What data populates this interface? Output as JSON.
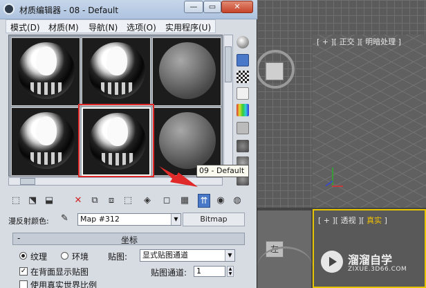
{
  "window": {
    "title": "材质编辑器 - 08 - Default",
    "minimize": "—",
    "restore": "▭",
    "close": "✕"
  },
  "menu": {
    "items": [
      "模式(D)",
      "材质(M)",
      "导航(N)",
      "选项(O)",
      "实用程序(U)"
    ]
  },
  "tooltip": "09 - Default",
  "diffuse": {
    "label": "漫反射颜色:",
    "map_value": "Map #312",
    "bitmap_button": "Bitmap"
  },
  "coordinates": {
    "toggle": "-",
    "title": "坐标",
    "texture_label": "纹理",
    "environ_label": "环境",
    "texture_selected": true,
    "mapping_label": "贴图:",
    "mapping_value": "显式贴图通道",
    "show_back_label": "在背面显示贴图",
    "show_back_checked": true,
    "real_world_label": "使用真实世界比例",
    "channel_label": "贴图通道:",
    "channel_value": "1"
  },
  "viewports": {
    "front_label": "[ + ][ 正交 ][ 明暗处理 ]",
    "persp_label_prefix": "[ + ][ 透视 ][",
    "persp_label_mode": " 真实 ",
    "persp_label_suffix": "]",
    "left_glyph": "左"
  },
  "watermark": {
    "name": "溜溜自学",
    "url": "ZIXUE.3D66.COM"
  },
  "colors": {
    "highlight_box": "#e02a2a",
    "arrow": "#e02a2a",
    "active_viewport": "#e8c600"
  }
}
